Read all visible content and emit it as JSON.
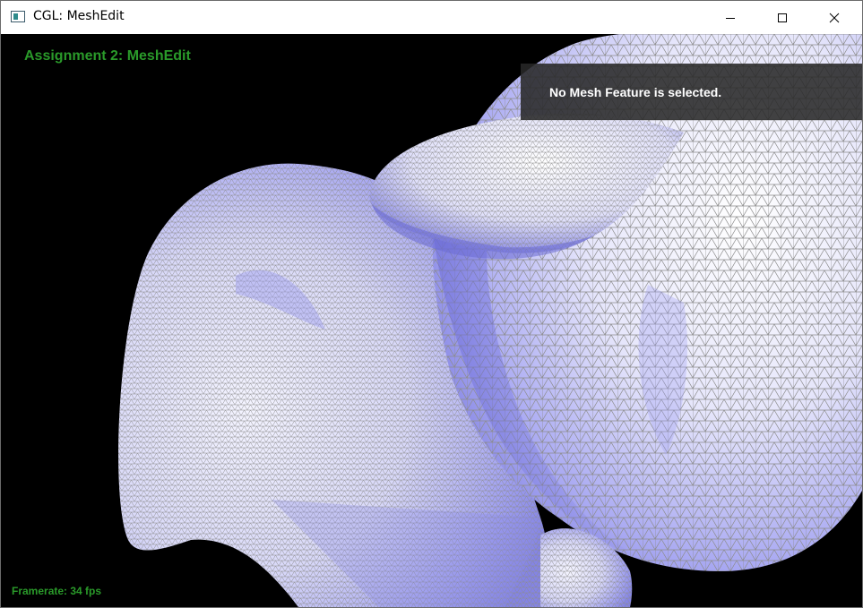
{
  "window": {
    "title": "CGL: MeshEdit",
    "icon": "app-window-icon",
    "controls": {
      "minimize_icon": "minimize-icon",
      "maximize_icon": "maximize-icon",
      "close_icon": "close-icon"
    }
  },
  "viewport": {
    "assignment_title": "Assignment 2: MeshEdit",
    "selection_info": "No Mesh Feature is selected.",
    "framerate": "Framerate: 34 fps"
  },
  "colors": {
    "overlay_text": "#2a9a2a",
    "background": "#000000",
    "mesh_fill_light": "#f2f2ff",
    "mesh_fill_shadow": "#8a8af0",
    "wireframe": "#8c8c8c"
  }
}
